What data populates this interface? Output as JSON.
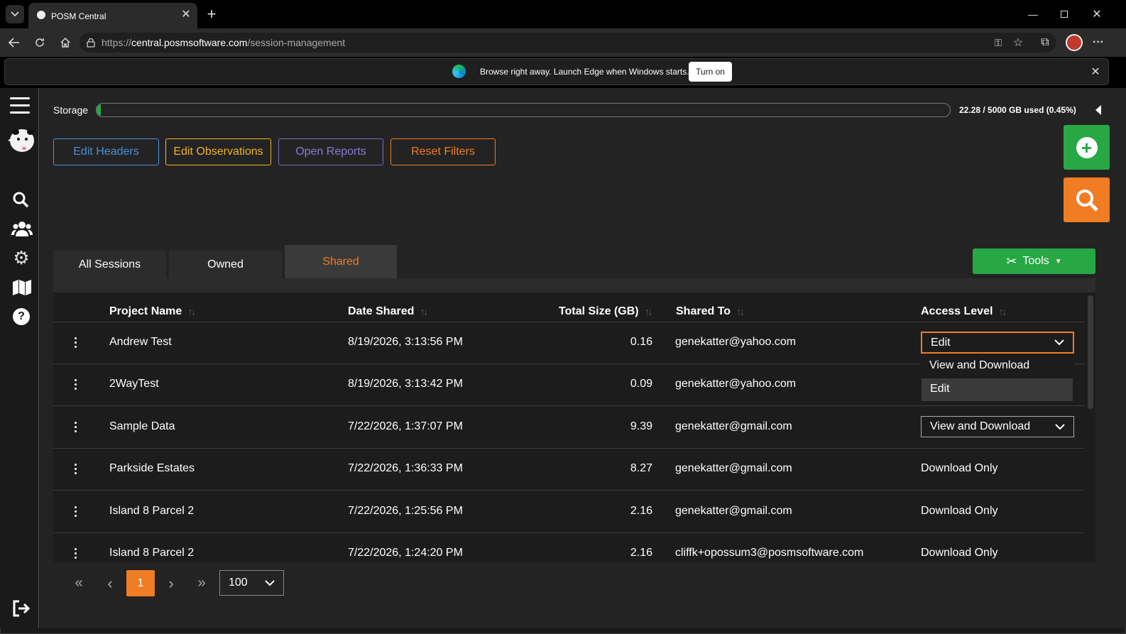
{
  "browser": {
    "tab_title": "POSM Central",
    "url_prefix": "https://",
    "url_host": "central.posmsoftware.com",
    "url_path": "/session-management",
    "notification_text": "Browse right away. Launch Edge when Windows starts.",
    "notification_button": "Turn on"
  },
  "storage": {
    "label": "Storage",
    "usage_text": "22.28 / 5000 GB used (0.45%)",
    "used_fraction": 0.0045
  },
  "actions": {
    "edit_headers": "Edit Headers",
    "edit_observations": "Edit Observations",
    "open_reports": "Open Reports",
    "reset_filters": "Reset Filters"
  },
  "tabs": {
    "all": "All Sessions",
    "owned": "Owned",
    "shared": "Shared"
  },
  "tools_label": "Tools",
  "columns": {
    "project_name": "Project Name",
    "date_shared": "Date Shared",
    "total_size": "Total Size (GB)",
    "shared_to": "Shared To",
    "access_level": "Access Level"
  },
  "rows": [
    {
      "name": "Andrew Test",
      "date": "8/19/2026, 3:13:56 PM",
      "size": "0.16",
      "shared_to": "genekatter@yahoo.com",
      "access": "Edit"
    },
    {
      "name": "2WayTest",
      "date": "8/19/2026, 3:13:42 PM",
      "size": "0.09",
      "shared_to": "genekatter@yahoo.com",
      "access": ""
    },
    {
      "name": "Sample Data",
      "date": "7/22/2026, 1:37:07 PM",
      "size": "9.39",
      "shared_to": "genekatter@gmail.com",
      "access": "View and Download"
    },
    {
      "name": "Parkside Estates",
      "date": "7/22/2026, 1:36:33 PM",
      "size": "8.27",
      "shared_to": "genekatter@gmail.com",
      "access": "Download Only"
    },
    {
      "name": "Island 8 Parcel 2",
      "date": "7/22/2026, 1:25:56 PM",
      "size": "2.16",
      "shared_to": "genekatter@gmail.com",
      "access": "Download Only"
    },
    {
      "name": "Island 8 Parcel 2",
      "date": "7/22/2026, 1:24:20 PM",
      "size": "2.16",
      "shared_to": "cliffk+opossum3@posmsoftware.com",
      "access": "Download Only"
    }
  ],
  "dropdown_options": [
    "View and Download",
    "Edit"
  ],
  "pagination": {
    "first": "«",
    "prev": "‹",
    "current": "1",
    "next": "›",
    "last": "»",
    "page_size": "100"
  },
  "colors": {
    "accent_orange": "#f07c24",
    "accent_green": "#28a745",
    "blue": "#4a90d9",
    "yellow": "#f0b429",
    "purple": "#8a7bd6"
  }
}
